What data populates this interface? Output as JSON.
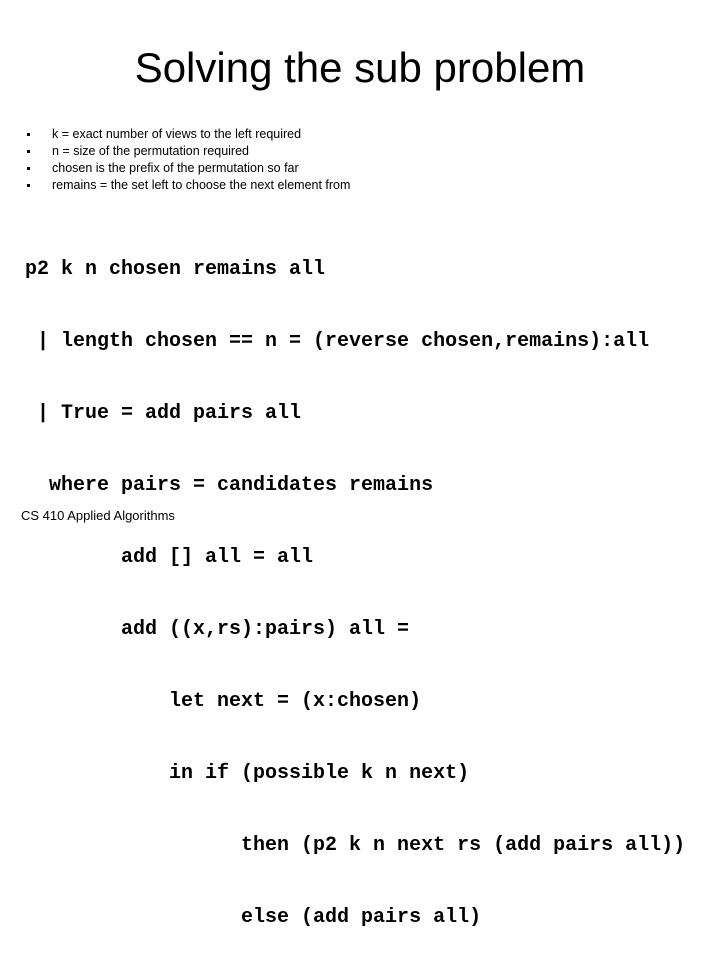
{
  "slide": {
    "title": "Solving the sub problem",
    "bullets": [
      "k = exact number of views to the left required",
      "n = size of the permutation required",
      "chosen is the prefix of the permutation so far",
      "remains = the set left to choose the next element from"
    ],
    "code_lines": [
      "p2 k n chosen remains all",
      " | length chosen == n = (reverse chosen,remains):all",
      " | True = add pairs all",
      "  where pairs = candidates remains",
      "        add [] all = all",
      "        add ((x,rs):pairs) all =",
      "            let next = (x:chosen)",
      "            in if (possible k n next)",
      "                  then (p2 k n next rs (add pairs all))",
      "                  else (add pairs all)"
    ],
    "footer": "CS 410  Applied Algorithms"
  }
}
